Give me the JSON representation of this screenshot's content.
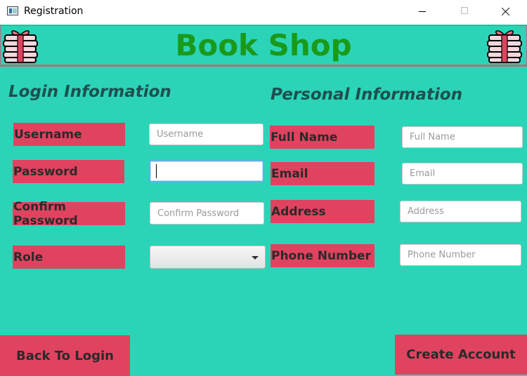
{
  "window": {
    "title": "Registration"
  },
  "header": {
    "title": "Book Shop"
  },
  "login": {
    "heading": "Login Information",
    "username_label": "Username",
    "username_placeholder": "Username",
    "username_value": "",
    "password_label": "Password",
    "password_value": "",
    "confirm_label": "Confirm Password",
    "confirm_placeholder": "Confirm Password",
    "confirm_value": "",
    "role_label": "Role",
    "role_value": ""
  },
  "personal": {
    "heading": "Personal Information",
    "fullname_label": "Full Name",
    "fullname_placeholder": "Full Name",
    "email_label": "Email",
    "email_placeholder": "Email",
    "address_label": "Address",
    "address_placeholder": "Address",
    "phone_label": "Phone Number",
    "phone_placeholder": "Phone Number"
  },
  "actions": {
    "back_label": "Back To Login",
    "create_label": "Create Account"
  },
  "colors": {
    "background": "#2bd4b7",
    "label_bg": "#e0435f",
    "title_green": "#1a9a1a",
    "heading_color": "#1e4f50"
  },
  "icons": {
    "header_left": "books-gift-icon",
    "header_right": "books-gift-icon"
  }
}
